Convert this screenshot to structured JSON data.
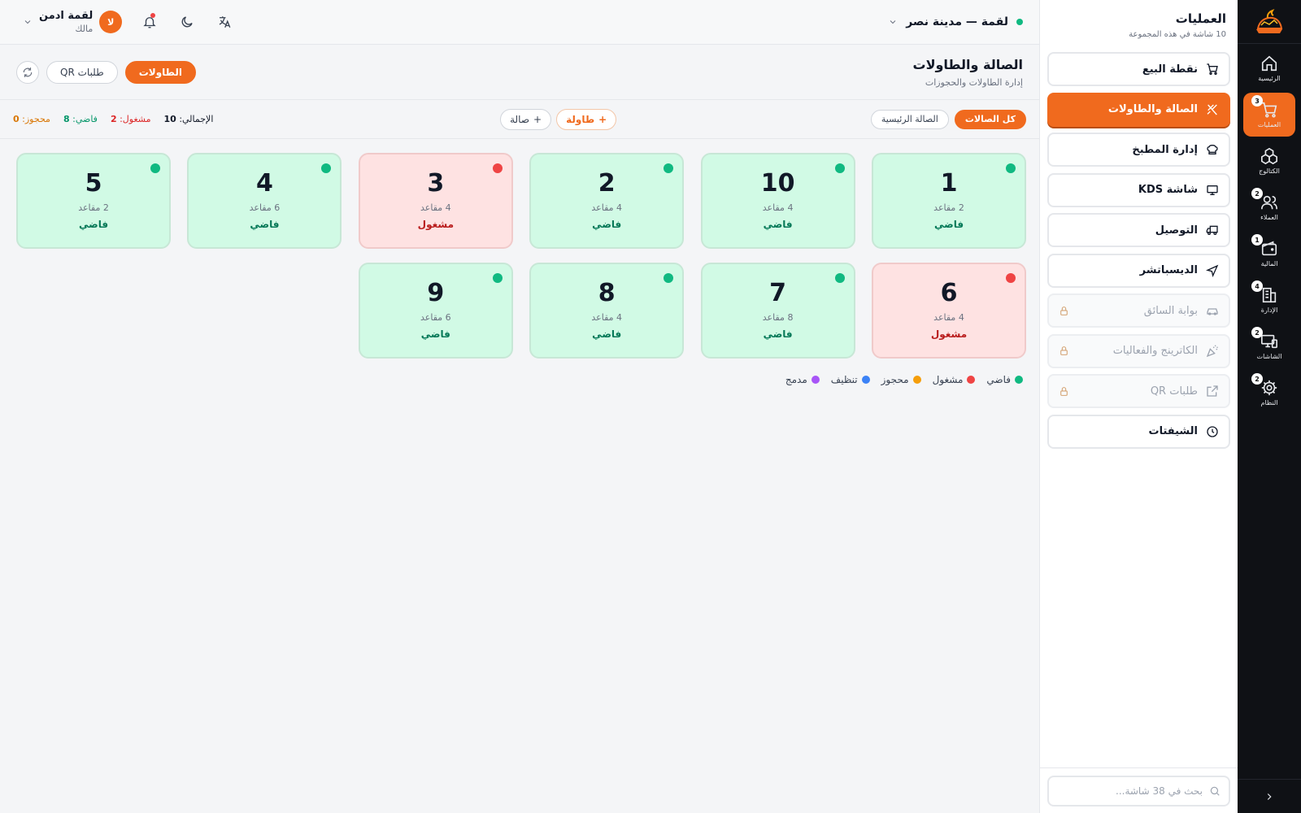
{
  "rail": {
    "items": [
      {
        "label": "الرئيسية",
        "icon": "home-icon",
        "badge": ""
      },
      {
        "label": "العمليات",
        "icon": "cart-icon",
        "badge": "3"
      },
      {
        "label": "الكتالوج",
        "icon": "boxes-icon",
        "badge": ""
      },
      {
        "label": "العملاء",
        "icon": "users-icon",
        "badge": "2"
      },
      {
        "label": "المالية",
        "icon": "wallet-icon",
        "badge": "1"
      },
      {
        "label": "الإدارة",
        "icon": "building-icon",
        "badge": "4"
      },
      {
        "label": "الشاشات",
        "icon": "monitor-icon",
        "badge": "2"
      },
      {
        "label": "النظام",
        "icon": "gear-icon",
        "badge": "2"
      }
    ]
  },
  "panel": {
    "title": "العمليات",
    "subtitle": "10 شاشة في هذه المجموعة",
    "items": [
      {
        "label": "نقطة البيع",
        "icon": "cart-icon"
      },
      {
        "label": "الصالة والطاولات",
        "icon": "utensils-icon"
      },
      {
        "label": "إدارة المطبخ",
        "icon": "chef-hat-icon"
      },
      {
        "label": "شاشة KDS",
        "icon": "monitor-icon"
      },
      {
        "label": "التوصيل",
        "icon": "truck-icon"
      },
      {
        "label": "الديسباتشر",
        "icon": "navigation-icon"
      },
      {
        "label": "بوابة السائق",
        "icon": "car-icon"
      },
      {
        "label": "الكاترينج والفعاليات",
        "icon": "party-icon"
      },
      {
        "label": "طلبات QR",
        "icon": "external-link-icon"
      },
      {
        "label": "الشيفتات",
        "icon": "clock-icon"
      }
    ],
    "search_placeholder": "بحث في 38 شاشة..."
  },
  "topbar": {
    "branch": "لقمة — مدينة نصر",
    "user_name": "لقمة ادمن",
    "user_role": "مالك",
    "avatar_letter": "لا"
  },
  "page": {
    "title": "الصالة والطاولات",
    "subtitle": "إدارة الطاولات والحجوزات",
    "tab_tables": "الطاولات",
    "tab_qr": "طلبات QR"
  },
  "filters": {
    "all_halls": "كل الصالات",
    "main_hall": "الصالة الرئيسية",
    "add_table": "طاولة",
    "add_hall": "صالة"
  },
  "stats": {
    "total_label": "الإجمالي:",
    "total_value": "10",
    "busy_label": "مشغول:",
    "busy_value": "2",
    "free_label": "فاضي:",
    "free_value": "8",
    "reserved_label": "محجوز:",
    "reserved_value": "0"
  },
  "tables": [
    {
      "number": "1",
      "seats": "2 مقاعد",
      "status": "فاضي",
      "state": "free"
    },
    {
      "number": "10",
      "seats": "4 مقاعد",
      "status": "فاضي",
      "state": "free"
    },
    {
      "number": "2",
      "seats": "4 مقاعد",
      "status": "فاضي",
      "state": "free"
    },
    {
      "number": "3",
      "seats": "4 مقاعد",
      "status": "مشغول",
      "state": "busy"
    },
    {
      "number": "4",
      "seats": "6 مقاعد",
      "status": "فاضي",
      "state": "free"
    },
    {
      "number": "5",
      "seats": "2 مقاعد",
      "status": "فاضي",
      "state": "free"
    },
    {
      "number": "6",
      "seats": "4 مقاعد",
      "status": "مشغول",
      "state": "busy"
    },
    {
      "number": "7",
      "seats": "8 مقاعد",
      "status": "فاضي",
      "state": "free"
    },
    {
      "number": "8",
      "seats": "4 مقاعد",
      "status": "فاضي",
      "state": "free"
    },
    {
      "number": "9",
      "seats": "6 مقاعد",
      "status": "فاضي",
      "state": "free"
    }
  ],
  "legend": [
    {
      "label": "فاضي",
      "color": "#10b981"
    },
    {
      "label": "مشغول",
      "color": "#ef4444"
    },
    {
      "label": "محجوز",
      "color": "#f59e0b"
    },
    {
      "label": "تنظيف",
      "color": "#3b82f6"
    },
    {
      "label": "مدمج",
      "color": "#a855f7"
    }
  ],
  "colors": {
    "accent": "#f06a1e",
    "free": "#10b981",
    "busy": "#ef4444"
  }
}
